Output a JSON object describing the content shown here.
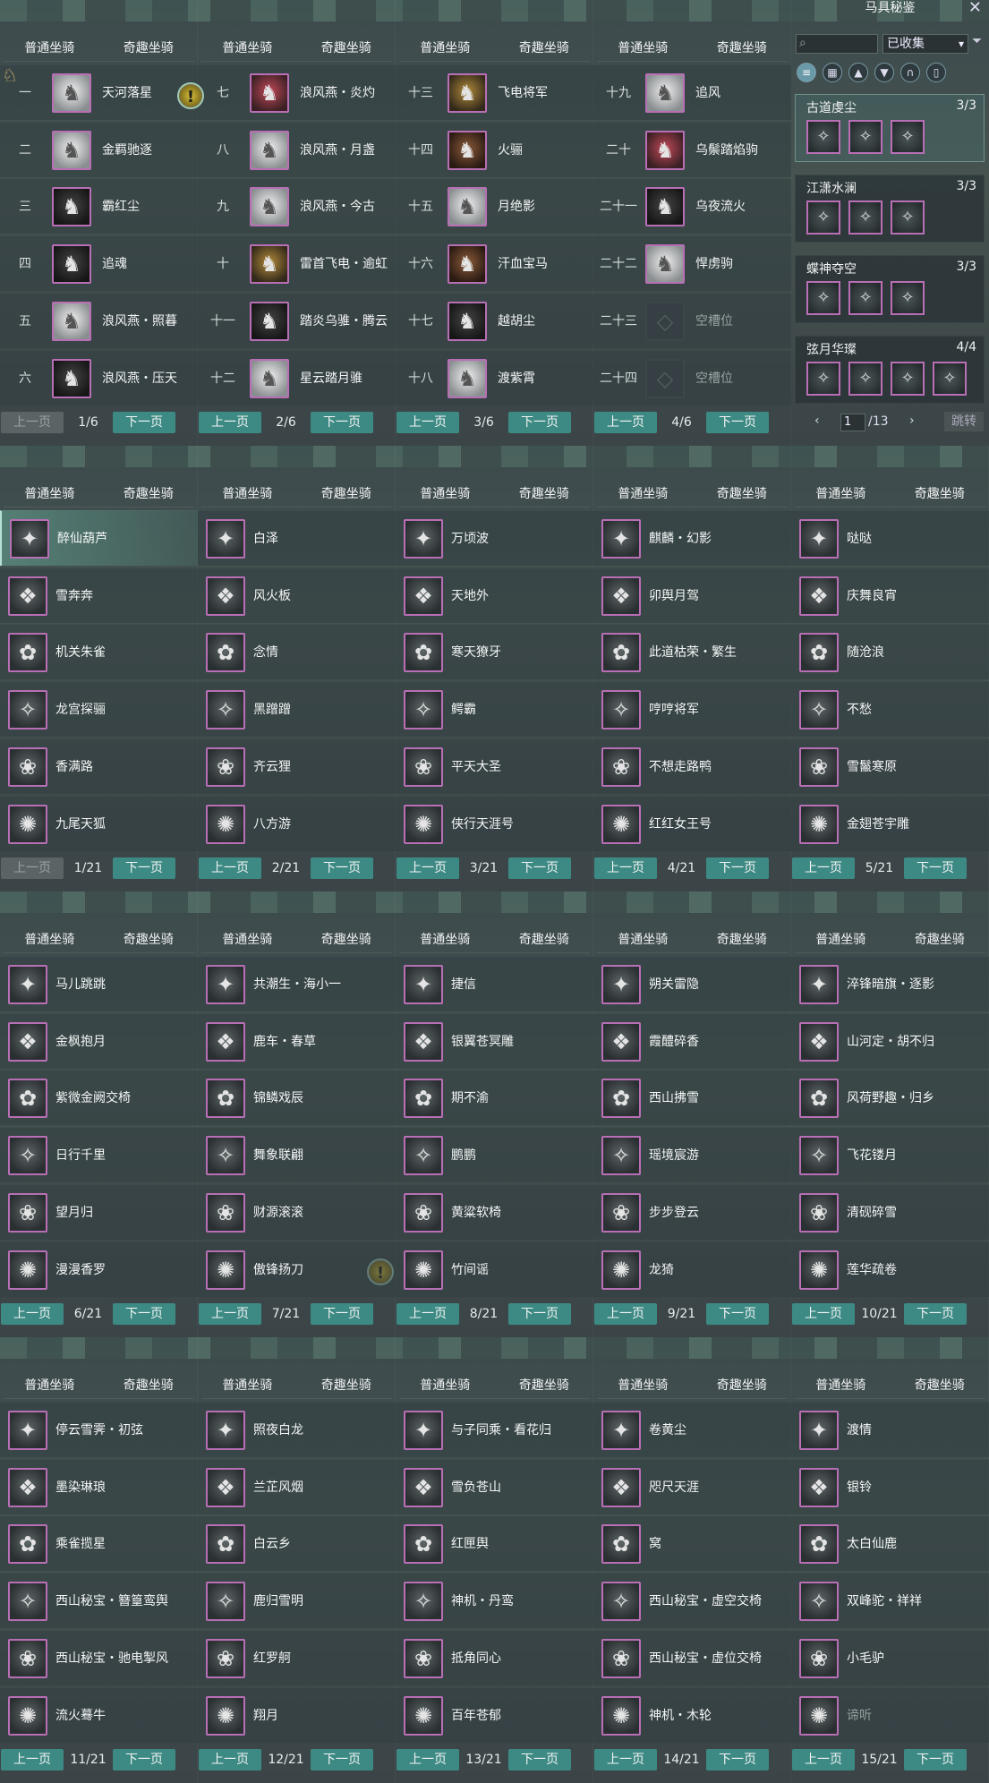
{
  "tabs": {
    "normal": "普通坐骑",
    "fun": "奇趣坐骑"
  },
  "pager": {
    "prev": "上一页",
    "next": "下一页"
  },
  "mount_panels": [
    {
      "page": "1/6",
      "rows": [
        {
          "idx": "一",
          "name": "天河落星",
          "icon": "white"
        },
        {
          "idx": "二",
          "name": "金羁驰逐",
          "icon": "white"
        },
        {
          "idx": "三",
          "name": "霸红尘",
          "icon": "dark"
        },
        {
          "idx": "四",
          "name": "追魂",
          "icon": "dark"
        },
        {
          "idx": "五",
          "name": "浪风燕・照暮",
          "icon": "white"
        },
        {
          "idx": "六",
          "name": "浪风燕・压天",
          "icon": "dark"
        }
      ]
    },
    {
      "page": "2/6",
      "rows": [
        {
          "idx": "七",
          "name": "浪风燕・炎灼",
          "icon": "red"
        },
        {
          "idx": "八",
          "name": "浪风燕・月盏",
          "icon": "white"
        },
        {
          "idx": "九",
          "name": "浪风燕・今古",
          "icon": "white"
        },
        {
          "idx": "十",
          "name": "雷首飞电・逾虹",
          "icon": "gold"
        },
        {
          "idx": "十一",
          "name": "踏炎乌骓・腾云",
          "icon": "dark"
        },
        {
          "idx": "十二",
          "name": "星云踏月骓",
          "icon": "white"
        }
      ]
    },
    {
      "page": "3/6",
      "rows": [
        {
          "idx": "十三",
          "name": "飞电将军",
          "icon": "gold"
        },
        {
          "idx": "十四",
          "name": "火骊",
          "icon": "brown"
        },
        {
          "idx": "十五",
          "name": "月绝影",
          "icon": "white"
        },
        {
          "idx": "十六",
          "name": "汗血宝马",
          "icon": "brown"
        },
        {
          "idx": "十七",
          "name": "越胡尘",
          "icon": "dark"
        },
        {
          "idx": "十八",
          "name": "渡紫霄",
          "icon": "white"
        }
      ]
    },
    {
      "page": "4/6",
      "rows": [
        {
          "idx": "十九",
          "name": "追风",
          "icon": "white"
        },
        {
          "idx": "二十",
          "name": "乌鬃踏焰驹",
          "icon": "red"
        },
        {
          "idx": "二十一",
          "name": "乌夜流火",
          "icon": "dark"
        },
        {
          "idx": "二十二",
          "name": "悍虏驹",
          "icon": "white"
        },
        {
          "idx": "二十三",
          "name": "空槽位",
          "icon": "empty"
        },
        {
          "idx": "二十四",
          "name": "空槽位",
          "icon": "empty"
        }
      ]
    }
  ],
  "fun_panels": [
    {
      "page": "1/21",
      "names": [
        "醉仙葫芦",
        "雪奔奔",
        "机关朱雀",
        "龙宫探骊",
        "香满路",
        "九尾天狐"
      ]
    },
    {
      "page": "2/21",
      "names": [
        "白泽",
        "风火板",
        "念情",
        "黑蹭蹭",
        "齐云狸",
        "八方游"
      ]
    },
    {
      "page": "3/21",
      "names": [
        "万顷波",
        "天地外",
        "寒天獠牙",
        "鳄霸",
        "平天大圣",
        "侠行天涯号"
      ]
    },
    {
      "page": "4/21",
      "names": [
        "麒麟・幻影",
        "卯舆月驾",
        "此道枯荣・繁生",
        "哼哼将军",
        "不想走路鸭",
        "红红女王号"
      ]
    },
    {
      "page": "5/21",
      "names": [
        "哒哒",
        "庆舞良宵",
        "随沧浪",
        "不愁",
        "雪鬣寒原",
        "金翅苍宇雕"
      ]
    },
    {
      "page": "6/21",
      "names": [
        "马儿跳跳",
        "金枫抱月",
        "紫微金阙交椅",
        "日行千里",
        "望月归",
        "漫漫香罗"
      ]
    },
    {
      "page": "7/21",
      "names": [
        "共潮生・海小一",
        "鹿车・春草",
        "锦鳞戏辰",
        "舞象联翩",
        "财源滚滚",
        "傲锋扬刀"
      ]
    },
    {
      "page": "8/21",
      "names": [
        "捷信",
        "银翼苍冥雕",
        "期不渝",
        "鹏鹏",
        "黄粱软椅",
        "竹间谣"
      ]
    },
    {
      "page": "9/21",
      "names": [
        "朔关雷隐",
        "霞醴碎香",
        "西山拂雪",
        "瑶境宸游",
        "步步登云",
        "龙猗"
      ]
    },
    {
      "page": "10/21",
      "names": [
        "淬锋暗旗・逐影",
        "山河定・胡不归",
        "风荷野趣・归乡",
        "飞花镂月",
        "清砚碎雪",
        "莲华疏卷"
      ]
    },
    {
      "page": "11/21",
      "names": [
        "停云雪霁・初弦",
        "墨染琳琅",
        "乘雀揽星",
        "西山秘宝・簪篁鸾舆",
        "西山秘宝・驰电掣风",
        "流火蓦牛"
      ]
    },
    {
      "page": "12/21",
      "names": [
        "照夜白龙",
        "兰芷风烟",
        "白云乡",
        "鹿归雪明",
        "红罗舸",
        "翔月"
      ]
    },
    {
      "page": "13/21",
      "names": [
        "与子同乘・看花归",
        "雪负苍山",
        "红匣舆",
        "神机・丹鸾",
        "抵角同心",
        "百年苍郁"
      ]
    },
    {
      "page": "14/21",
      "names": [
        "卷黄尘",
        "咫尺天涯",
        "窝",
        "西山秘宝・虚空交椅",
        "西山秘宝・虚位交椅",
        "神机・木轮"
      ]
    },
    {
      "page": "15/21",
      "names": [
        "渡情",
        "银铃",
        "太白仙鹿",
        "双峰驼・祥祥",
        "小毛驴",
        "谛听"
      ]
    }
  ],
  "codex": {
    "title": "马具秘鉴",
    "filter_value": "已收集",
    "sets": [
      {
        "name": "古道虔尘",
        "count": "3/3",
        "items": 3
      },
      {
        "name": "江潇水澜",
        "count": "3/3",
        "items": 3
      },
      {
        "name": "蝶神夺空",
        "count": "3/3",
        "items": 3
      },
      {
        "name": "弦月华璨",
        "count": "4/4",
        "items": 4
      }
    ],
    "page_input": "1",
    "page_total": "/13",
    "jump_label": "跳转"
  }
}
